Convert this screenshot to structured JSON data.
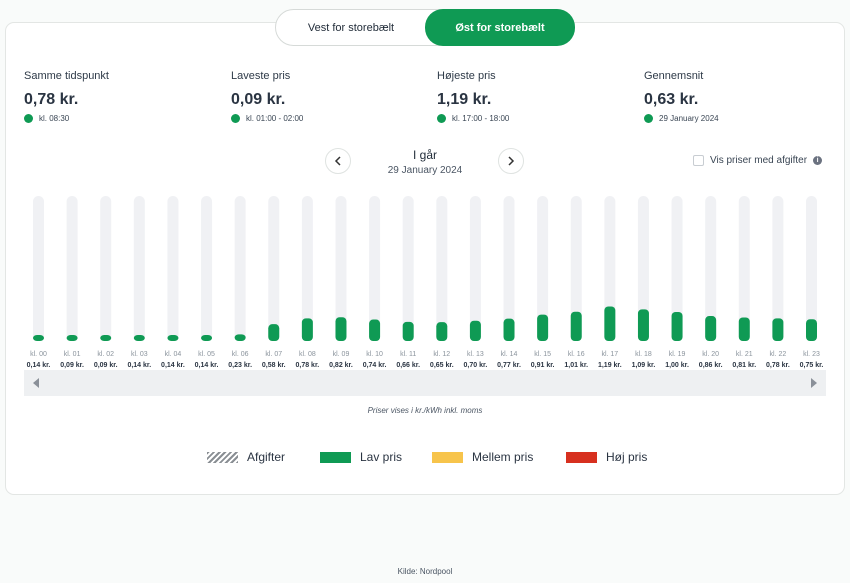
{
  "toggle": {
    "west_label": "Vest for storebælt",
    "east_label": "Øst for storebælt",
    "active": "east"
  },
  "stats": {
    "current": {
      "label": "Samme tidspunkt",
      "value": "0,78 kr.",
      "sub": "kl. 08:30"
    },
    "lowest": {
      "label": "Laveste pris",
      "value": "0,09 kr.",
      "sub": "kl. 01:00 - 02:00"
    },
    "highest": {
      "label": "Højeste pris",
      "value": "1,19 kr.",
      "sub": "kl. 17:00 - 18:00"
    },
    "average": {
      "label": "Gennemsnit",
      "value": "0,63 kr.",
      "sub": "29 January 2024"
    }
  },
  "date_nav": {
    "title": "I går",
    "date": "29 January 2024",
    "prev_icon": "chevron-left-icon",
    "next_icon": "chevron-right-icon"
  },
  "vat_toggle": {
    "label": "Vis priser med afgifter",
    "checked": false
  },
  "chart_data": {
    "type": "bar",
    "categories": [
      "kl. 00",
      "kl. 01",
      "kl. 02",
      "kl. 03",
      "kl. 04",
      "kl. 05",
      "kl. 06",
      "kl. 07",
      "kl. 08",
      "kl. 09",
      "kl. 10",
      "kl. 11",
      "kl. 12",
      "kl. 13",
      "kl. 14",
      "kl. 15",
      "kl. 16",
      "kl. 17",
      "kl. 18",
      "kl. 19",
      "kl. 20",
      "kl. 21",
      "kl. 22",
      "kl. 23"
    ],
    "values": [
      0.14,
      0.09,
      0.09,
      0.14,
      0.14,
      0.14,
      0.23,
      0.58,
      0.78,
      0.82,
      0.74,
      0.66,
      0.65,
      0.7,
      0.77,
      0.91,
      1.01,
      1.19,
      1.09,
      1.0,
      0.86,
      0.81,
      0.78,
      0.75
    ],
    "value_labels": [
      "0,14 kr.",
      "0,09 kr.",
      "0,09 kr.",
      "0,14 kr.",
      "0,14 kr.",
      "0,14 kr.",
      "0,23 kr.",
      "0,58 kr.",
      "0,78 kr.",
      "0,82 kr.",
      "0,74 kr.",
      "0,66 kr.",
      "0,65 kr.",
      "0,70 kr.",
      "0,77 kr.",
      "0,91 kr.",
      "1,01 kr.",
      "1,19 kr.",
      "1,09 kr.",
      "1,00 kr.",
      "0,86 kr.",
      "0,81 kr.",
      "0,78 kr.",
      "0,75 kr."
    ],
    "ylim": [
      0,
      5
    ],
    "bar_color": "#0f9a54",
    "track_color": "#f0f1f4"
  },
  "note": "Priser vises i kr./kWh inkl. moms",
  "legend": {
    "fees": "Afgifter",
    "low": "Lav pris",
    "mid": "Mellem pris",
    "high": "Høj pris"
  },
  "colors": {
    "accent": "#0f9a54",
    "mid": "#f7c44b",
    "high": "#d7301f"
  },
  "source": "Kilde: Nordpool"
}
